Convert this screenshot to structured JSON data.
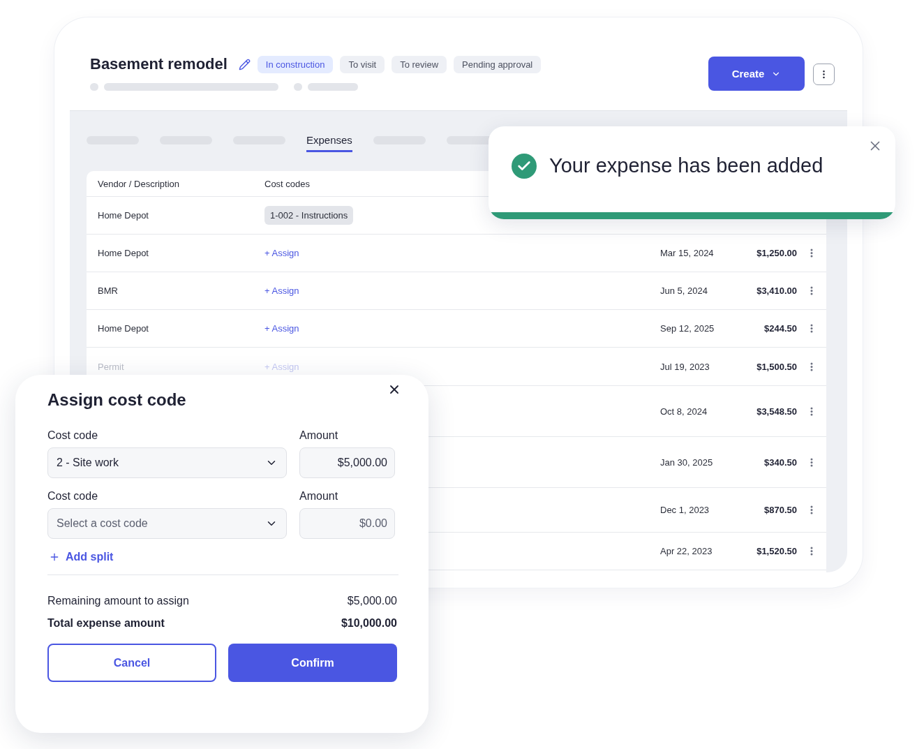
{
  "project": {
    "title": "Basement remodel",
    "statuses": [
      {
        "label": "In construction",
        "selected": true
      },
      {
        "label": "To visit",
        "selected": false
      },
      {
        "label": "To review",
        "selected": false
      },
      {
        "label": "Pending approval",
        "selected": false
      }
    ],
    "create_button": "Create"
  },
  "tabs": [
    {
      "kind": "placeholder"
    },
    {
      "kind": "placeholder"
    },
    {
      "kind": "placeholder"
    },
    {
      "kind": "label",
      "label": "Expenses",
      "selected": true
    },
    {
      "kind": "placeholder"
    },
    {
      "kind": "placeholder"
    }
  ],
  "table": {
    "columns": [
      "Vendor / Description",
      "Cost codes"
    ],
    "rows": [
      {
        "vendor": "Home Depot",
        "cost_code": {
          "kind": "tag",
          "text": "1-002 - Instructions"
        }
      },
      {
        "vendor": "Home Depot",
        "cost_code": {
          "kind": "link",
          "text": "+ Assign"
        },
        "date": "Mar 15, 2024",
        "amount": "$1,250.00"
      },
      {
        "vendor": "BMR",
        "cost_code": {
          "kind": "link",
          "text": "+ Assign"
        },
        "date": "Jun 5, 2024",
        "amount": "$3,410.00"
      },
      {
        "vendor": "Home Depot",
        "cost_code": {
          "kind": "link",
          "text": "+ Assign"
        },
        "date": "Sep 12, 2025",
        "amount": "$244.50"
      },
      {
        "vendor": "Permit",
        "faded": true,
        "cost_code": {
          "kind": "link",
          "text": "+ Assign"
        },
        "date": "Jul 19, 2023",
        "amount": "$1,500.50"
      },
      {
        "date": "Oct 8, 2024",
        "amount": "$3,548.50"
      },
      {
        "date": "Jan 30, 2025",
        "amount": "$340.50"
      },
      {
        "date": "Dec 1, 2023",
        "amount": "$870.50"
      },
      {
        "date": "Apr 22, 2023",
        "amount": "$1,520.50"
      }
    ]
  },
  "toast": {
    "message": "Your expense has been added",
    "level": 1
  },
  "dialog": {
    "title": "Assign cost code",
    "splits": [
      {
        "code_label": "Cost code",
        "code_value": "2 - Site work",
        "amount_label": "Amount",
        "amount_value": "$5,000.00"
      },
      {
        "code_label": "Cost code",
        "code_placeholder": "Select a cost code",
        "amount_label": "Amount",
        "amount_placeholder": "$0.00"
      }
    ],
    "add_split": "Add split",
    "summary": [
      {
        "label": "Remaining amount to assign",
        "value": "$5,000.00",
        "bold": false
      },
      {
        "label": "Total expense amount",
        "value": "$10,000.00",
        "bold": true
      }
    ],
    "cancel": "Cancel",
    "confirm": "Confirm"
  }
}
